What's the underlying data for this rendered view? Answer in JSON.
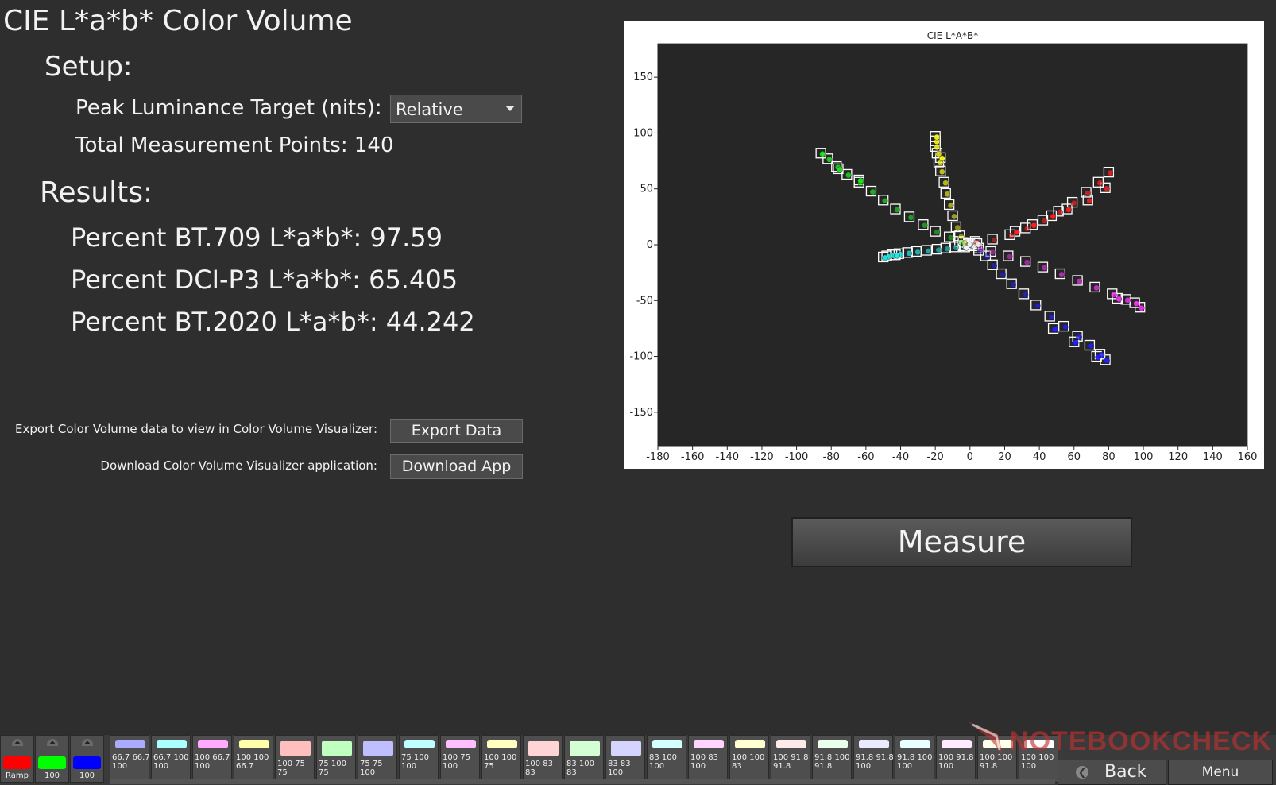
{
  "title": "CIE L*a*b* Color Volume",
  "setup": {
    "heading": "Setup:",
    "peak_label": "Peak Luminance Target (nits):",
    "peak_value": "Relative",
    "total_points": "Total Measurement Points: 140"
  },
  "results": {
    "heading": "Results:",
    "bt709": "Percent BT.709 L*a*b*: 97.59",
    "dcip3": "Percent DCI-P3 L*a*b*: 65.405",
    "bt2020": "Percent BT.2020 L*a*b*: 44.242"
  },
  "export": {
    "label": "Export Color Volume data to view in Color Volume Visualizer:",
    "button": "Export Data"
  },
  "download": {
    "label": "Download Color Volume Visualizer application:",
    "button": "Download App"
  },
  "measure_button": "Measure",
  "toolbar": {
    "ramp_buttons": [
      {
        "label": "Ramp",
        "color": "#ff0000"
      },
      {
        "label": "100",
        "color": "#00ff00"
      },
      {
        "label": "100",
        "color": "#0000ff"
      }
    ],
    "patches": [
      {
        "label": "66.7 66.7 100",
        "color": "#aaaaff"
      },
      {
        "label": "66.7 100 100",
        "color": "#aaffff"
      },
      {
        "label": "100 66.7 100",
        "color": "#ffaaff"
      },
      {
        "label": "100 100 66.7",
        "color": "#ffffaa"
      },
      {
        "label": "100 75 75",
        "color": "#ffbfbf"
      },
      {
        "label": "75 100 75",
        "color": "#bfffbf"
      },
      {
        "label": "75 75 100",
        "color": "#bfbfff"
      },
      {
        "label": "75 100 100",
        "color": "#bfffff"
      },
      {
        "label": "100 75 100",
        "color": "#ffbfff"
      },
      {
        "label": "100 100 75",
        "color": "#ffffbf"
      },
      {
        "label": "100 83 83",
        "color": "#ffd4d4"
      },
      {
        "label": "83 100 83",
        "color": "#d4ffd4"
      },
      {
        "label": "83 83 100",
        "color": "#d4d4ff"
      },
      {
        "label": "83 100 100",
        "color": "#d4ffff"
      },
      {
        "label": "100 83 100",
        "color": "#ffd4ff"
      },
      {
        "label": "100 100 83",
        "color": "#ffffd4"
      },
      {
        "label": "100 91.8 91.8",
        "color": "#ffeaea"
      },
      {
        "label": "91.8 100 91.8",
        "color": "#eaffea"
      },
      {
        "label": "91.8 91.8 100",
        "color": "#eaeaff"
      },
      {
        "label": "91.8 100 100",
        "color": "#eaffff"
      },
      {
        "label": "100 91.8 100",
        "color": "#ffeaff"
      },
      {
        "label": "100 100 91.8",
        "color": "#ffffea"
      },
      {
        "label": "100 100 100",
        "color": "#ffffff"
      }
    ],
    "back": "Back",
    "menu": "Menu"
  },
  "watermark": "NOTEBOOKCHECK",
  "chart_data": {
    "type": "scatter",
    "title": "CIE L*A*B*",
    "xlabel": "",
    "ylabel": "",
    "xlim": [
      -180,
      160
    ],
    "ylim": [
      -180,
      180
    ],
    "x_ticks": [
      -180,
      -160,
      -140,
      -120,
      -100,
      -80,
      -60,
      -40,
      -20,
      0,
      20,
      40,
      60,
      80,
      100,
      120,
      140,
      160
    ],
    "y_ticks": [
      150,
      100,
      50,
      0,
      -50,
      -100,
      -150
    ],
    "background": "#262626",
    "series": [
      {
        "color": "#ff2020",
        "points": [
          [
            3,
            3
          ],
          [
            13,
            5
          ],
          [
            23,
            9
          ],
          [
            32,
            15
          ],
          [
            42,
            22
          ],
          [
            51,
            30
          ],
          [
            59,
            38
          ],
          [
            67,
            47
          ],
          [
            74,
            56
          ],
          [
            80,
            65
          ],
          [
            78,
            51
          ],
          [
            68,
            40
          ],
          [
            56,
            32
          ],
          [
            47,
            26
          ],
          [
            36,
            18
          ],
          [
            26,
            12
          ]
        ]
      },
      {
        "color": "#20e020",
        "points": [
          [
            -6,
            3
          ],
          [
            -12,
            7
          ],
          [
            -20,
            12
          ],
          [
            -27,
            18
          ],
          [
            -35,
            25
          ],
          [
            -43,
            32
          ],
          [
            -50,
            40
          ],
          [
            -57,
            48
          ],
          [
            -64,
            56
          ],
          [
            -71,
            63
          ],
          [
            -77,
            70
          ],
          [
            -82,
            77
          ],
          [
            -86,
            82
          ],
          [
            -76,
            68
          ],
          [
            -64,
            58
          ]
        ]
      },
      {
        "color": "#2020ff",
        "points": [
          [
            5,
            -5
          ],
          [
            9,
            -10
          ],
          [
            13,
            -18
          ],
          [
            18,
            -26
          ],
          [
            24,
            -35
          ],
          [
            31,
            -44
          ],
          [
            38,
            -54
          ],
          [
            46,
            -64
          ],
          [
            54,
            -73
          ],
          [
            62,
            -82
          ],
          [
            69,
            -90
          ],
          [
            75,
            -98
          ],
          [
            78,
            -103
          ],
          [
            73,
            -100
          ],
          [
            60,
            -87
          ],
          [
            48,
            -75
          ]
        ]
      },
      {
        "color": "#20e6e6",
        "points": [
          [
            -4,
            -1
          ],
          [
            -9,
            -2
          ],
          [
            -14,
            -3
          ],
          [
            -19,
            -4
          ],
          [
            -25,
            -5
          ],
          [
            -31,
            -6
          ],
          [
            -36,
            -7
          ],
          [
            -41,
            -8
          ],
          [
            -45,
            -9
          ],
          [
            -48,
            -10
          ],
          [
            -50,
            -11
          ],
          [
            -43,
            -9
          ]
        ]
      },
      {
        "color": "#ee30ee",
        "points": [
          [
            5,
            -3
          ],
          [
            12,
            -6
          ],
          [
            22,
            -10
          ],
          [
            32,
            -15
          ],
          [
            42,
            -20
          ],
          [
            52,
            -26
          ],
          [
            62,
            -32
          ],
          [
            72,
            -38
          ],
          [
            82,
            -44
          ],
          [
            90,
            -49
          ],
          [
            95,
            -52
          ],
          [
            98,
            -56
          ],
          [
            85,
            -48
          ]
        ]
      },
      {
        "color": "#f0f020",
        "points": [
          [
            -4,
            2
          ],
          [
            -6,
            8
          ],
          [
            -8,
            16
          ],
          [
            -10,
            26
          ],
          [
            -12,
            36
          ],
          [
            -14,
            46
          ],
          [
            -15,
            56
          ],
          [
            -17,
            66
          ],
          [
            -18,
            74
          ],
          [
            -19,
            82
          ],
          [
            -20,
            88
          ],
          [
            -20,
            93
          ],
          [
            -20,
            97
          ],
          [
            -17,
            78
          ]
        ]
      },
      {
        "color": "#f4f4f4",
        "points": [
          [
            0,
            0
          ],
          [
            2,
            -1
          ],
          [
            -1,
            1
          ],
          [
            4,
            1
          ],
          [
            -3,
            -2
          ]
        ]
      }
    ]
  }
}
